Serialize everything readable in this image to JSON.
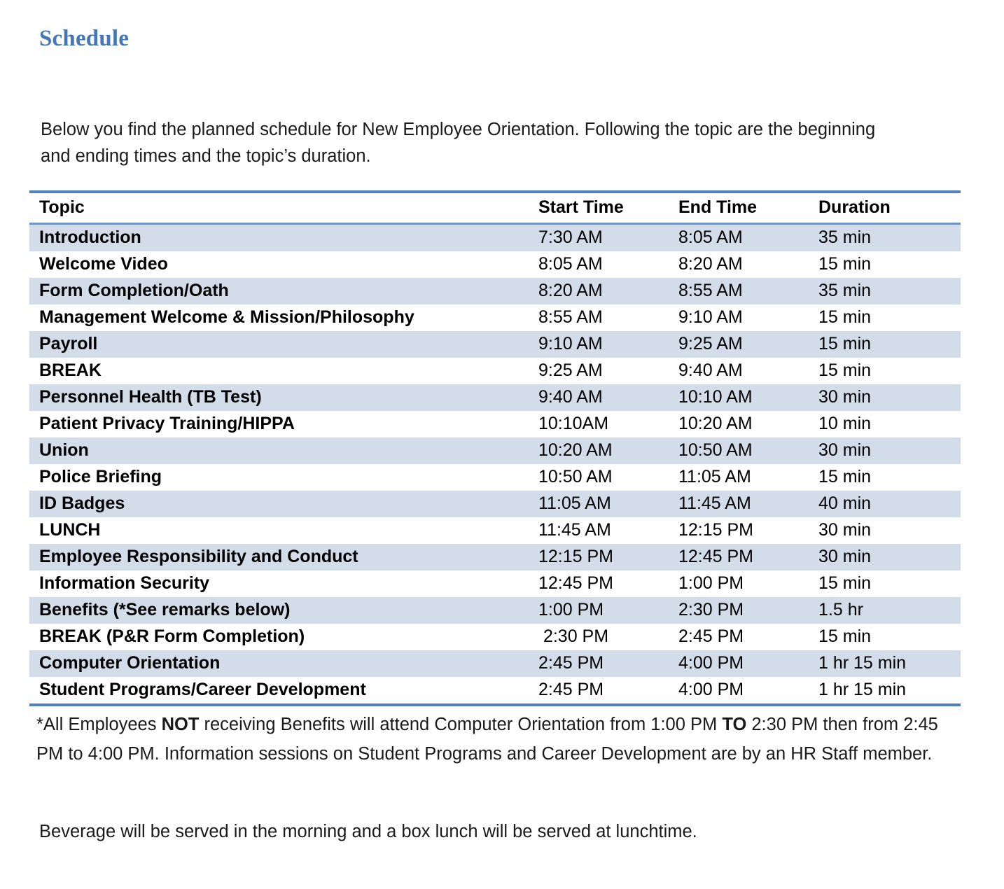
{
  "document": {
    "title": "Schedule",
    "title_color": "#4576b5",
    "intro_paragraph": "Below you find the planned schedule for New Employee Orientation.  Following the topic are the beginning and ending times and the topic’s duration."
  },
  "table": {
    "accent_color": "#4f81bd",
    "shaded_row_color": "#d3dce9",
    "columns": [
      "Topic",
      "Start Time",
      "End Time",
      "Duration"
    ],
    "rows": [
      {
        "topic": "Introduction",
        "start": "7:30 AM",
        "end": "8:05 AM",
        "duration": "35 min"
      },
      {
        "topic": "Welcome Video",
        "start": "8:05 AM",
        "end": "8:20 AM",
        "duration": "15 min"
      },
      {
        "topic": "Form Completion/Oath",
        "start": "8:20 AM",
        "end": "8:55 AM",
        "duration": "35 min"
      },
      {
        "topic": "Management Welcome & Mission/Philosophy",
        "start": "8:55 AM",
        "end": "9:10 AM",
        "duration": "15 min"
      },
      {
        "topic": "Payroll",
        "start": "9:10 AM",
        "end": "9:25 AM",
        "duration": "15 min"
      },
      {
        "topic": "BREAK",
        "start": "9:25 AM",
        "end": "9:40 AM",
        "duration": "15 min"
      },
      {
        "topic": "Personnel Health (TB Test)",
        "start": "9:40 AM",
        "end": "10:10 AM",
        "duration": "30 min"
      },
      {
        "topic": "Patient Privacy Training/HIPPA",
        "start": "10:10AM",
        "end": "10:20 AM",
        "duration": "10 min"
      },
      {
        "topic": "Union",
        "start": "10:20 AM",
        "end": "10:50 AM",
        "duration": "30 min"
      },
      {
        "topic": "Police Briefing",
        "start": "10:50 AM",
        "end": "11:05 AM",
        "duration": "15 min"
      },
      {
        "topic": "ID Badges",
        "start": "11:05 AM",
        "end": "11:45 AM",
        "duration": "40 min"
      },
      {
        "topic": "LUNCH",
        "start": "11:45 AM",
        "end": "12:15 PM",
        "duration": "30 min"
      },
      {
        "topic": "Employee Responsibility and Conduct",
        "start": "12:15 PM",
        "end": "12:45 PM",
        "duration": "30 min"
      },
      {
        "topic": "Information Security",
        "start": "12:45 PM",
        "end": "1:00 PM",
        "duration": "15 min"
      },
      {
        "topic": "Benefits (*See remarks below)",
        "start": "1:00 PM",
        "end": "2:30 PM",
        "duration": "1.5 hr"
      },
      {
        "topic": "BREAK (P&R Form Completion)",
        "start": " 2:30 PM",
        "end": "2:45 PM",
        "duration": "15 min"
      },
      {
        "topic": "Computer Orientation",
        "start": "2:45 PM",
        "end": "4:00 PM",
        "duration": "1 hr 15 min"
      },
      {
        "topic": "Student Programs/Career Development",
        "start": "2:45 PM",
        "end": "4:00 PM",
        "duration": "1 hr 15 min"
      }
    ]
  },
  "footnote": {
    "part1": "*All Employees ",
    "emphasis1": "NOT",
    "part2": " receiving Benefits will attend Computer Orientation from 1:00 PM ",
    "emphasis2": "TO",
    "part3": " 2:30 PM then from 2:45 PM to 4:00 PM.  Information sessions on Student Programs and Career Development are by an HR Staff member."
  },
  "closing_paragraph": "Beverage will be served in the morning and a box lunch will be served at lunchtime."
}
